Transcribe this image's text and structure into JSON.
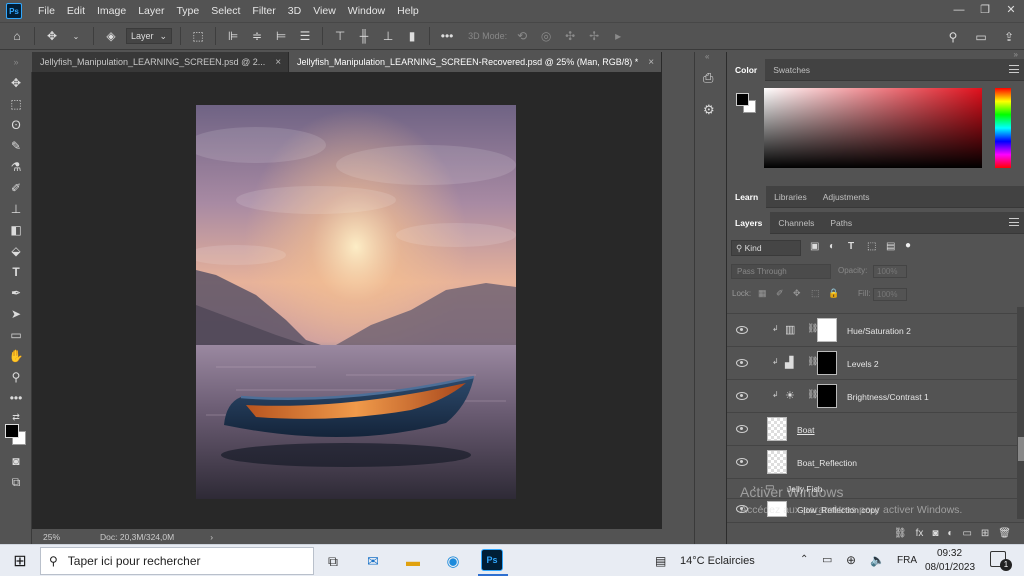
{
  "app": {
    "logo_text": "Ps"
  },
  "menu": [
    "File",
    "Edit",
    "Image",
    "Layer",
    "Type",
    "Select",
    "Filter",
    "3D",
    "View",
    "Window",
    "Help"
  ],
  "window_controls": {
    "minimize": "—",
    "restore": "❐",
    "close": "✕"
  },
  "options_bar": {
    "layer_dropdown": "Layer",
    "mode_3d_label": "3D Mode:"
  },
  "tabs": [
    {
      "label": "Jellyfish_Manipulation_LEARNING_SCREEN.psd @ 2...",
      "close": "×",
      "active": false
    },
    {
      "label": "Jellyfish_Manipulation_LEARNING_SCREEN-Recovered.psd @ 25% (Man, RGB/8) *",
      "close": "×",
      "active": true
    }
  ],
  "status": {
    "zoom": "25%",
    "doc": "Doc: 20,3M/324,0M",
    "arrow": "›"
  },
  "color_panel": {
    "tabs": [
      "Color",
      "Swatches"
    ],
    "active": "Color"
  },
  "learn_panel": {
    "tabs": [
      "Learn",
      "Libraries",
      "Adjustments"
    ],
    "active": "Learn"
  },
  "layers_panel": {
    "tabs": [
      "Layers",
      "Channels",
      "Paths"
    ],
    "active": "Layers",
    "filter": "Kind",
    "blend_mode": "Pass Through",
    "opacity_label": "Opacity:",
    "opacity_value": "100%",
    "lock_label": "Lock:",
    "fill_label": "Fill:",
    "fill_value": "100%",
    "layers": [
      {
        "name": "Hue/Saturation 2",
        "kind": "adjustment"
      },
      {
        "name": "Levels 2",
        "kind": "adjustment"
      },
      {
        "name": "Brightness/Contrast 1",
        "kind": "adjustment"
      },
      {
        "name": "Boat",
        "kind": "pixel"
      },
      {
        "name": "Boat_Reflection",
        "kind": "pixel"
      },
      {
        "name": "Jelly Fish",
        "kind": "group"
      },
      {
        "name": "Glow_Reflection copy",
        "kind": "pixel"
      }
    ]
  },
  "watermark": {
    "title": "Activer Windows",
    "subtitle": "Accédez aux paramètres pour activer Windows."
  },
  "taskbar": {
    "search_placeholder": "Taper ici pour rechercher",
    "weather": "14°C  Eclaircies",
    "language": "FRA",
    "time": "09:32",
    "date": "08/01/2023",
    "notifications": "1"
  },
  "colors": {
    "ps_blue": "#31a8ff",
    "panel_bg": "#535353",
    "canvas_bg": "#282828"
  }
}
